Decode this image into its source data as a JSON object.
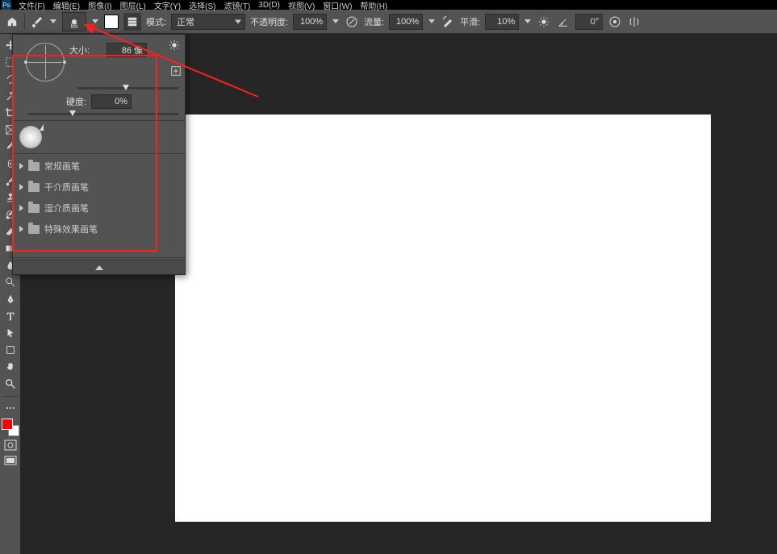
{
  "menubar": {
    "items": [
      "文件(F)",
      "编辑(E)",
      "图像(I)",
      "图层(L)",
      "文字(Y)",
      "选择(S)",
      "滤镜(T)",
      "3D(D)",
      "视图(V)",
      "窗口(W)",
      "帮助(H)"
    ]
  },
  "options": {
    "brushSizeLabel": "86",
    "modeLabel": "模式:",
    "modeValue": "正常",
    "opacityLabel": "不透明度:",
    "opacityValue": "100%",
    "flowLabel": "流量:",
    "flowValue": "100%",
    "smoothingLabel": "平滑:",
    "smoothingValue": "10%",
    "angleValue": "0°"
  },
  "brushPopup": {
    "sizeLabel": "大小:",
    "sizeValue": "86 像",
    "hardnessLabel": "硬度:",
    "hardnessValue": "0%",
    "folders": [
      "常规画笔",
      "干介质画笔",
      "湿介质画笔",
      "特殊效果画笔"
    ]
  },
  "colors": {
    "foreground": "#ff0000",
    "background": "#ffffff",
    "highlightRed": "#ff1e1e"
  },
  "tools": [
    "move",
    "marquee",
    "lasso",
    "wand",
    "crop",
    "frame",
    "eyedropper",
    "repair",
    "brush",
    "stamp",
    "history",
    "eraser",
    "gradient",
    "blur",
    "dodge",
    "pen",
    "type",
    "path",
    "shape",
    "hand",
    "zoom",
    "more"
  ]
}
